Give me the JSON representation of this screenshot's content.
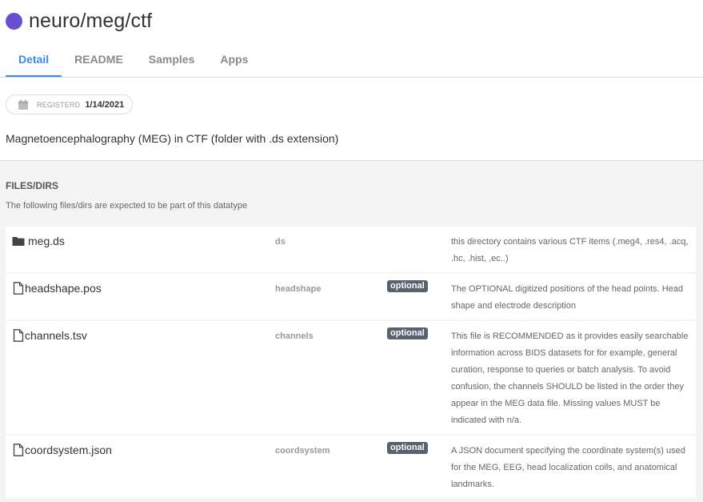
{
  "header": {
    "title": "neuro/meg/ctf",
    "dot_color": "#6a4ed1"
  },
  "tabs": [
    {
      "label": "Detail",
      "active": true
    },
    {
      "label": "README",
      "active": false
    },
    {
      "label": "Samples",
      "active": false
    },
    {
      "label": "Apps",
      "active": false
    }
  ],
  "accent_color": "#3f88e3",
  "registered": {
    "label": "REGISTERD",
    "date": "1/14/2021",
    "icon": "calendar-icon"
  },
  "description": "Magnetoencephalography (MEG) in CTF (folder with .ds extension)",
  "files": {
    "heading": "FILES/DIRS",
    "subtitle": "The following files/dirs are expected to be part of this datatype",
    "items": [
      {
        "icon": "folder-icon",
        "name": "meg.ds",
        "id": "ds",
        "optional": "",
        "description": "this directory contains various CTF items (.meg4, .res4, .acq, .hc, .hist, ,ec..)"
      },
      {
        "icon": "file-icon",
        "name": "headshape.pos",
        "id": "headshape",
        "optional": "optional",
        "description": "The OPTIONAL digitized positions of the head points. Head shape and electrode description"
      },
      {
        "icon": "file-icon",
        "name": "channels.tsv",
        "id": "channels",
        "optional": "optional",
        "description": "This file is RECOMMENDED as it provides easily searchable information across BIDS datasets for for example, general curation, response to queries or batch analysis. To avoid confusion, the channels SHOULD be listed in the order they appear in the MEG data file. Missing values MUST be indicated with n/a."
      },
      {
        "icon": "file-icon",
        "name": "coordsystem.json",
        "id": "coordsystem",
        "optional": "optional",
        "description": "A JSON document specifying the coordinate system(s) used for the MEG, EEG, head localization coils, and anatomical landmarks."
      }
    ]
  }
}
